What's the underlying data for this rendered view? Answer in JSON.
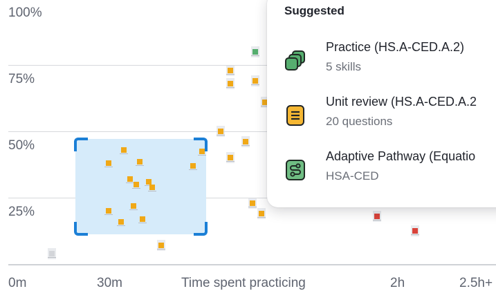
{
  "chart_data": {
    "type": "scatter",
    "ylabel_ticks": [
      "100%",
      "75%",
      "50%",
      "25%"
    ],
    "y_tick_values": [
      100,
      75,
      50,
      25
    ],
    "x_ticks": [
      {
        "label": "0m",
        "x": 0
      },
      {
        "label": "30m",
        "x": 30
      },
      {
        "label": "Time spent practicing",
        "x": 75
      },
      {
        "label": "2h",
        "x": 120
      },
      {
        "label": "2.5h+",
        "x": 150
      }
    ],
    "xlim": [
      0,
      156
    ],
    "ylim": [
      0,
      100
    ],
    "colors": {
      "gray": "#d3d5d9",
      "orange": "#f0a817",
      "green": "#56ae6f",
      "red": "#d9433a",
      "selection": "#d6ebfa",
      "handles": "#1b7fd6"
    },
    "points": [
      {
        "x": 14,
        "y": 4,
        "c": "gray"
      },
      {
        "x": 32,
        "y": 38,
        "c": "orange"
      },
      {
        "x": 37,
        "y": 43,
        "c": "orange"
      },
      {
        "x": 42,
        "y": 38.5,
        "c": "orange"
      },
      {
        "x": 39,
        "y": 32,
        "c": "orange"
      },
      {
        "x": 41,
        "y": 30,
        "c": "orange"
      },
      {
        "x": 45,
        "y": 31,
        "c": "orange"
      },
      {
        "x": 46,
        "y": 29,
        "c": "orange"
      },
      {
        "x": 40,
        "y": 22,
        "c": "orange"
      },
      {
        "x": 32,
        "y": 20,
        "c": "orange"
      },
      {
        "x": 36,
        "y": 16,
        "c": "orange"
      },
      {
        "x": 43,
        "y": 17,
        "c": "orange"
      },
      {
        "x": 49,
        "y": 7,
        "c": "orange"
      },
      {
        "x": 59,
        "y": 37,
        "c": "orange"
      },
      {
        "x": 62,
        "y": 42.5,
        "c": "orange"
      },
      {
        "x": 68,
        "y": 50,
        "c": "orange"
      },
      {
        "x": 71,
        "y": 40,
        "c": "orange"
      },
      {
        "x": 76,
        "y": 46,
        "c": "orange"
      },
      {
        "x": 71,
        "y": 73,
        "c": "orange"
      },
      {
        "x": 71,
        "y": 68,
        "c": "orange"
      },
      {
        "x": 79,
        "y": 69,
        "c": "orange"
      },
      {
        "x": 82,
        "y": 61,
        "c": "orange"
      },
      {
        "x": 79,
        "y": 80,
        "c": "green"
      },
      {
        "x": 78,
        "y": 23,
        "c": "orange"
      },
      {
        "x": 81,
        "y": 19,
        "c": "orange"
      },
      {
        "x": 118,
        "y": 18,
        "c": "red"
      },
      {
        "x": 130,
        "y": 12.5,
        "c": "red"
      }
    ]
  },
  "popover": {
    "title": "Suggested",
    "items": [
      {
        "icon": "practice-stack-icon",
        "title": "Practice (HS.A-CED.A.2)",
        "subtitle": "5 skills"
      },
      {
        "icon": "unit-review-icon",
        "title": "Unit review (HS.A-CED.A.2",
        "subtitle": "20 questions"
      },
      {
        "icon": "adaptive-pathway-icon",
        "title": "Adaptive Pathway (Equatio",
        "subtitle": "HSA-CED"
      }
    ]
  }
}
